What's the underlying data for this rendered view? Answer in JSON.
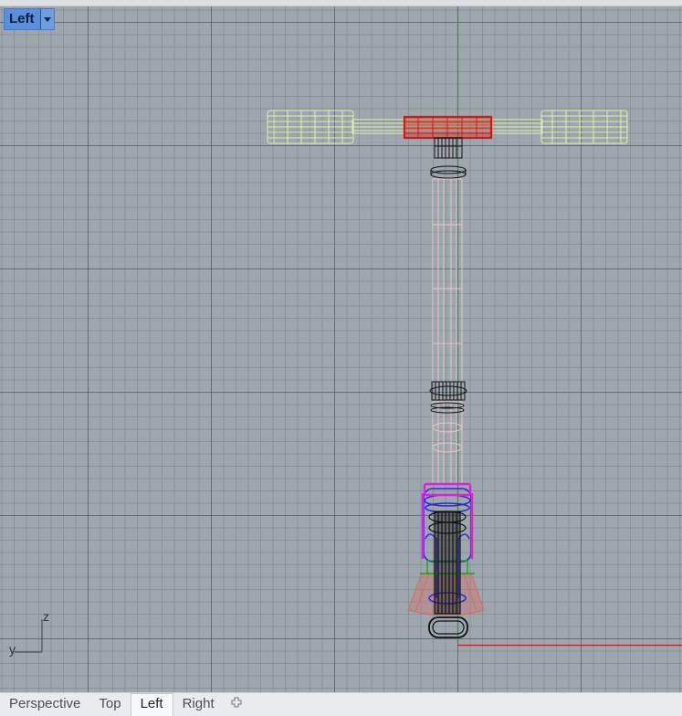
{
  "viewport": {
    "name": "Left",
    "axis_labels": {
      "vertical": "z",
      "horizontal": "y"
    }
  },
  "colors": {
    "grid_background": "#9ea6ae",
    "handle_grip": "#e3f0a8",
    "clamp": "#d21a12",
    "stem": "#e8c8c8",
    "collar": "#111111",
    "deck_outline": "#2a2ae0",
    "highlight": "#e020e0",
    "cone": "#d76a60",
    "y_axis": "#21a021",
    "x_axis": "#c02020"
  },
  "tabs": [
    {
      "label": "Perspective",
      "active": false
    },
    {
      "label": "Top",
      "active": false
    },
    {
      "label": "Left",
      "active": true
    },
    {
      "label": "Right",
      "active": false
    }
  ],
  "add_tab_icon": "plus-icon"
}
